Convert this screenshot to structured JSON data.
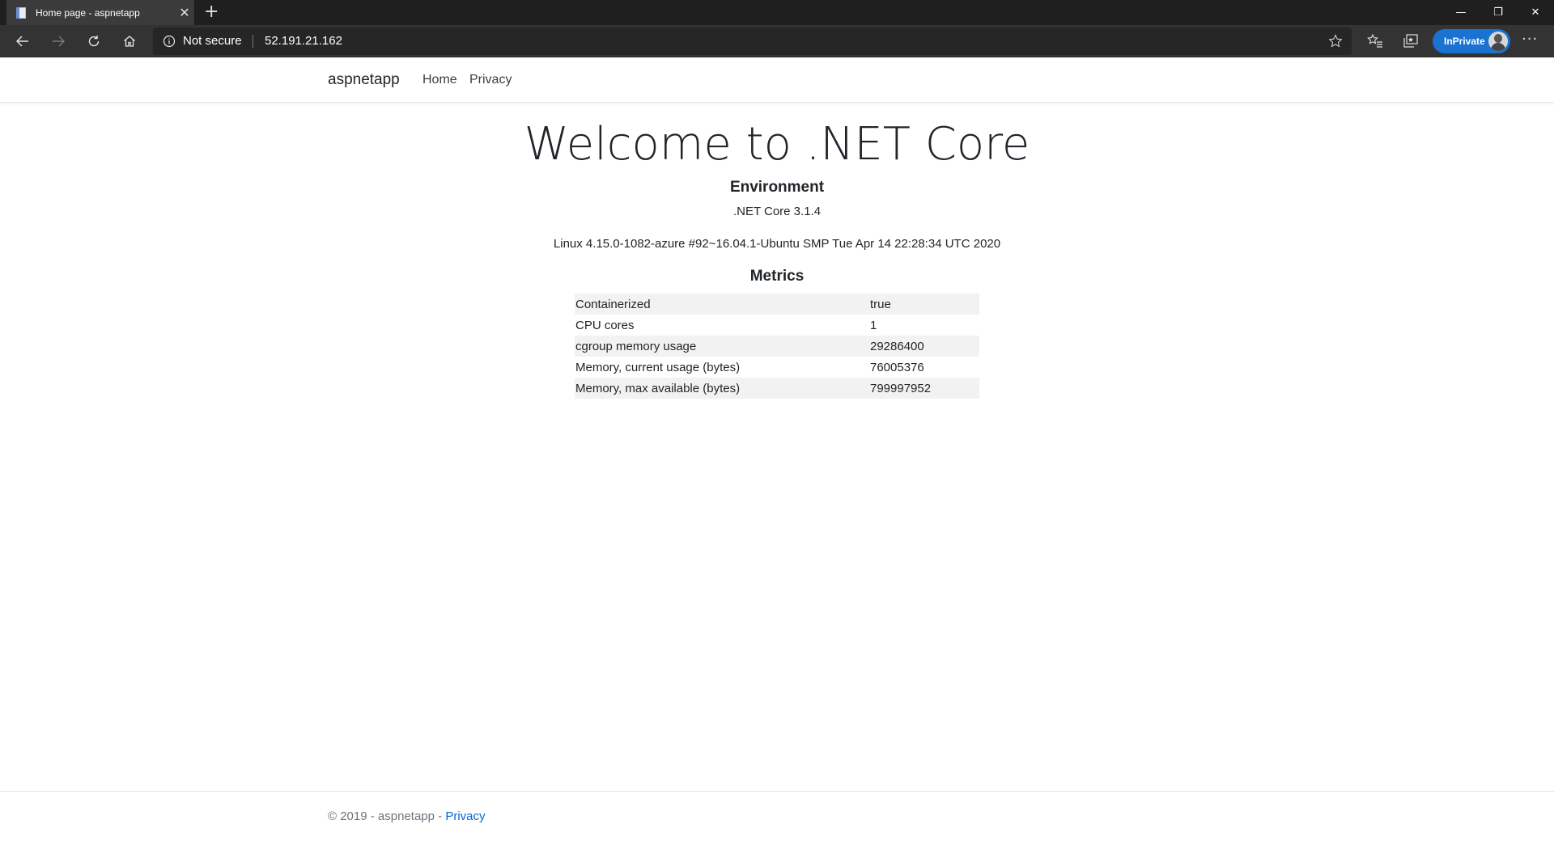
{
  "browser": {
    "tab": {
      "title": "Home page - aspnetapp",
      "close": "✕"
    },
    "new_tab": "+",
    "window_controls": {
      "minimize": "—",
      "restore": "❐",
      "close": "✕"
    },
    "address": {
      "security": "Not secure",
      "url": "52.191.21.162"
    },
    "inprivate_label": "InPrivate",
    "more": "···"
  },
  "site": {
    "brand": "aspnetapp",
    "nav": [
      {
        "label": "Home"
      },
      {
        "label": "Privacy"
      }
    ]
  },
  "main": {
    "title": "Welcome to .NET Core",
    "environment": {
      "heading": "Environment",
      "runtime": ".NET Core 3.1.4",
      "os": "Linux 4.15.0-1082-azure #92~16.04.1-Ubuntu SMP Tue Apr 14 22:28:34 UTC 2020"
    },
    "metrics": {
      "heading": "Metrics",
      "rows": [
        {
          "key": "Containerized",
          "value": "true"
        },
        {
          "key": "CPU cores",
          "value": "1"
        },
        {
          "key": "cgroup memory usage",
          "value": "29286400"
        },
        {
          "key": "Memory, current usage (bytes)",
          "value": "76005376"
        },
        {
          "key": "Memory, max available (bytes)",
          "value": "799997952"
        }
      ]
    }
  },
  "footer": {
    "text": "© 2019 - aspnetapp - ",
    "link": "Privacy"
  },
  "colors": {
    "chrome_dark": "#1f1f1f",
    "toolbar": "#333333",
    "inprivate": "#1a72d1",
    "link": "#0366d6",
    "stripe": "#f2f2f2"
  },
  "icons": [
    "page-favicon-icon",
    "back-arrow-icon",
    "forward-arrow-icon",
    "refresh-icon",
    "home-icon",
    "info-icon",
    "star-icon",
    "favorites-icon",
    "collections-icon"
  ]
}
